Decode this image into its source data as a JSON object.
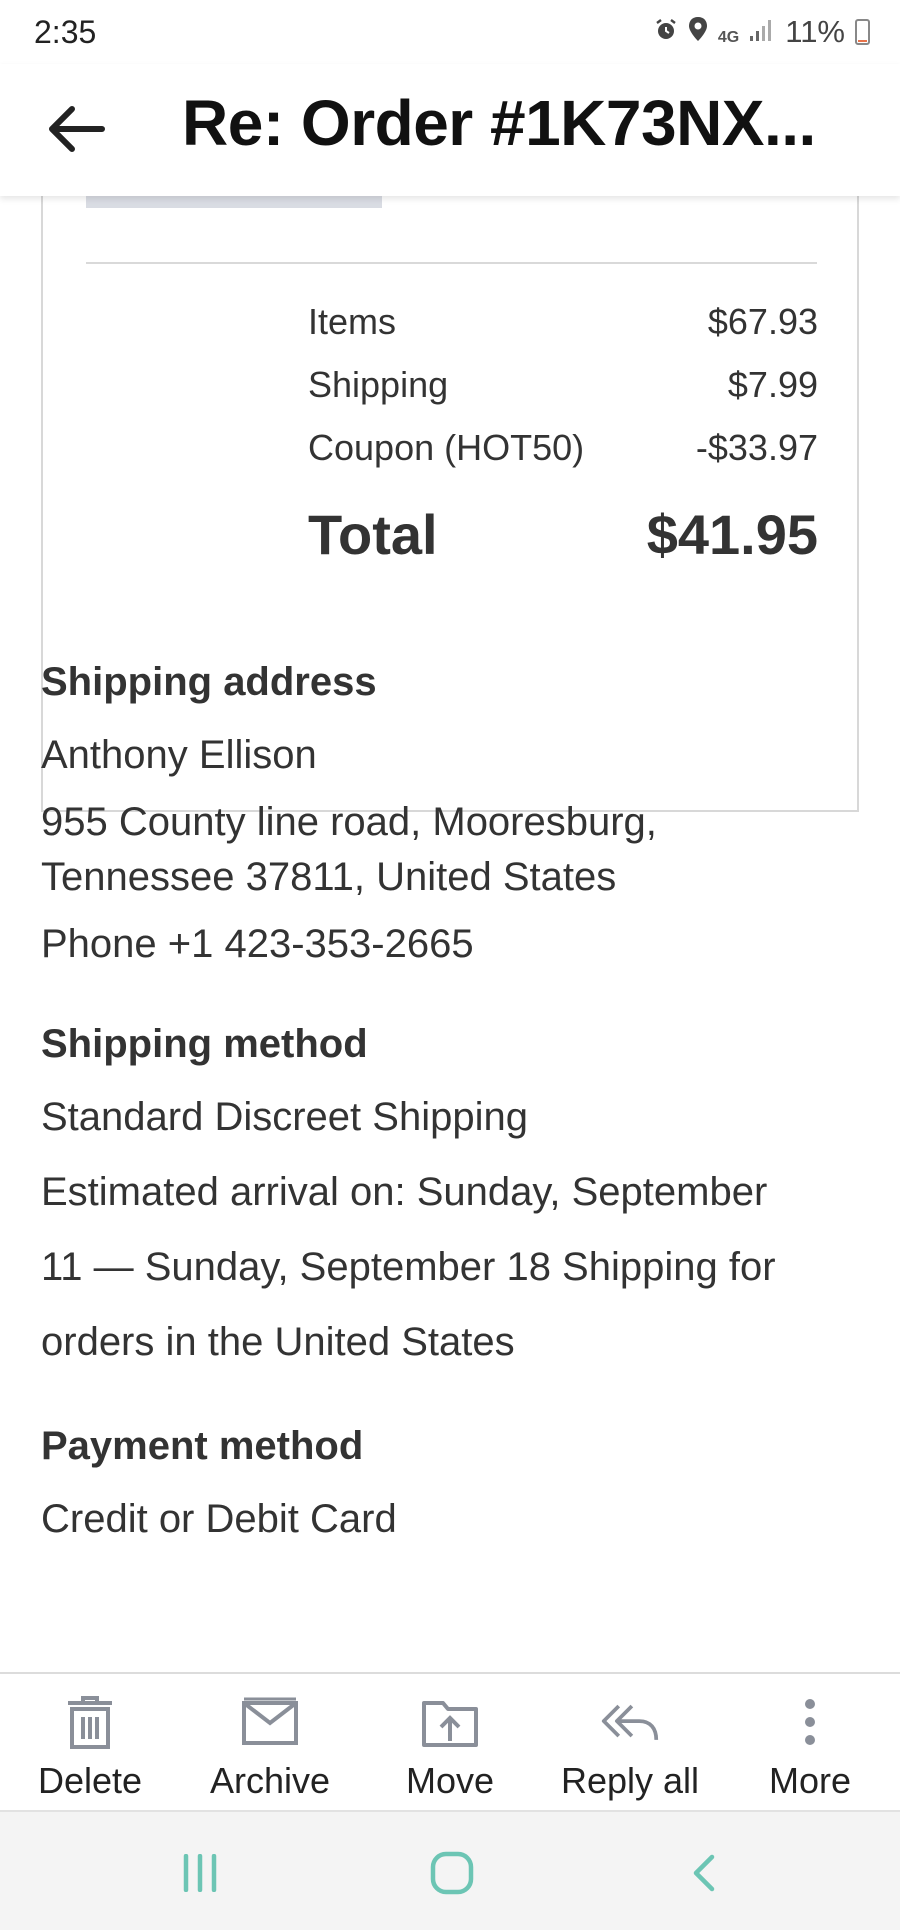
{
  "status_bar": {
    "time": "2:35",
    "network_label": "4G",
    "battery_percent": "11%",
    "battery_level": 0.11,
    "icons": [
      "alarm-icon",
      "location-icon",
      "network-icon",
      "signal-icon",
      "battery-icon"
    ]
  },
  "header": {
    "subject": "Re: Order #1K73NX..."
  },
  "summary": {
    "rows": [
      {
        "label": "Items",
        "value": "$67.93"
      },
      {
        "label": "Shipping",
        "value": "$7.99"
      },
      {
        "label": "Coupon (HOT50)",
        "value": "-$33.97"
      }
    ],
    "total_label": "Total",
    "total_value": "$41.95"
  },
  "shipping_address": {
    "heading": "Shipping address",
    "name": "Anthony Ellison",
    "line1": "955 County line road, Mooresburg,",
    "line2": "Tennessee 37811, United States",
    "phone": "Phone +1 423-353-2665"
  },
  "shipping_method": {
    "heading": "Shipping method",
    "method": "Standard Discreet Shipping",
    "eta_line1": "Estimated arrival on: Sunday, September",
    "eta_line2": "11 — Sunday, September 18 Shipping for",
    "eta_line3": "orders in the United States"
  },
  "payment_method": {
    "heading": "Payment method",
    "method": "Credit or Debit Card"
  },
  "toolbar": {
    "items": [
      {
        "label": "Delete",
        "icon": "trash-icon"
      },
      {
        "label": "Archive",
        "icon": "archive-icon"
      },
      {
        "label": "Move",
        "icon": "move-icon"
      },
      {
        "label": "Reply all",
        "icon": "reply-all-icon"
      },
      {
        "label": "More",
        "icon": "more-vertical-icon"
      }
    ]
  },
  "colors": {
    "nav_accent": "#6cc5b4",
    "toolbar_icon": "#8a8f99",
    "text": "#333333"
  }
}
